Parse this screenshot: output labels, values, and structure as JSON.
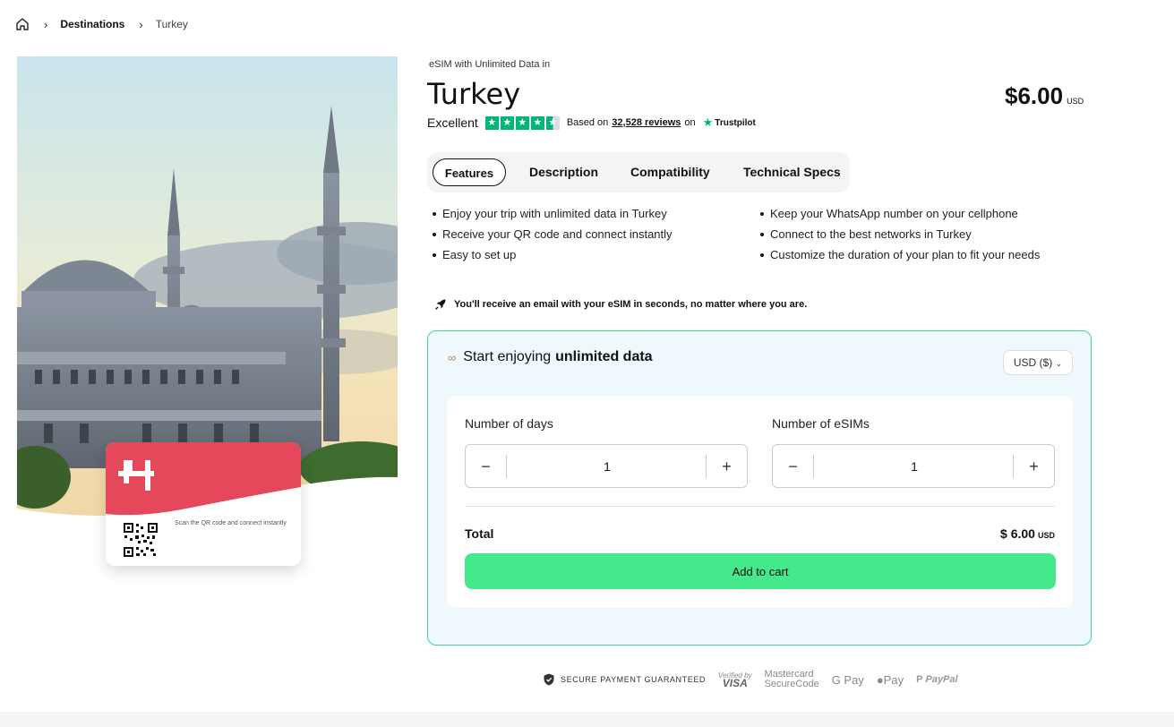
{
  "breadcrumb": {
    "home_icon": "home-icon",
    "items": [
      "Destinations",
      "Turkey"
    ]
  },
  "card": {
    "caption": "Scan the QR code and connect instantly",
    "brand_color": "#e5485b"
  },
  "product": {
    "subtitle": "eSIM with Unlimited Data in",
    "title": "Turkey",
    "price": "$6.00",
    "price_currency": "USD"
  },
  "rating": {
    "label": "Excellent",
    "stars": 4.5,
    "based_on": "Based on",
    "reviews": "32,528 reviews",
    "on": "on",
    "provider": "Trustpilot"
  },
  "tabs": [
    "Features",
    "Description",
    "Compatibility",
    "Technical Specs"
  ],
  "features": [
    "Enjoy your trip with unlimited data in Turkey",
    "Keep your WhatsApp number on your cellphone",
    "Receive your QR code and connect instantly",
    "Connect to the best networks in Turkey",
    "Easy to set up",
    "Customize the duration of your plan to fit your needs"
  ],
  "notice": "You'll receive an email with your eSIM in seconds, no matter where you are.",
  "panel": {
    "heading_prefix": "Start enjoying",
    "heading_bold": "unlimited data",
    "currency_select": "USD ($)",
    "days_label": "Number of days",
    "days_value": "1",
    "esims_label": "Number of eSIMs",
    "esims_value": "1",
    "minus": "−",
    "plus": "+",
    "total_label": "Total",
    "total_value": "$ 6.00",
    "total_currency": "USD",
    "add_to_cart": "Add to cart",
    "accent": "#46e88c"
  },
  "payments": {
    "secure": "SECURE PAYMENT GUARANTEED",
    "verified_by": "Verified by",
    "visa": "VISA",
    "mastercard_line1": "Mastercard",
    "mastercard_line2": "SecureCode",
    "gpay": "G Pay",
    "apay": "Pay",
    "paypal": "PayPal"
  }
}
